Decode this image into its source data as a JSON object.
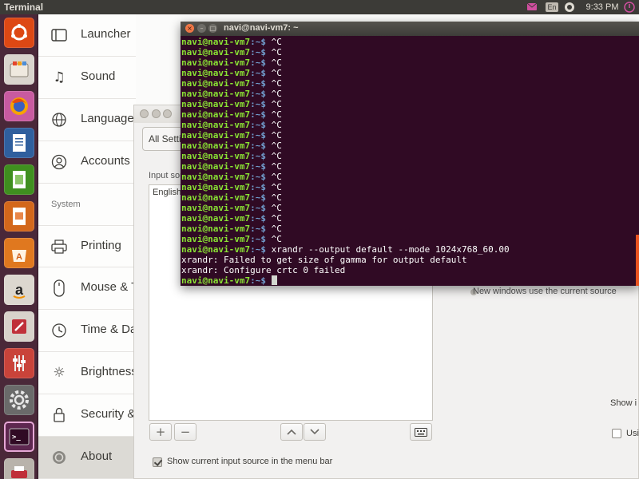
{
  "top_panel": {
    "title": "Terminal",
    "keyboard_indicator": "En",
    "time": "9:33 PM"
  },
  "launcher": {
    "items": [
      {
        "name": "dash-icon",
        "color": "#dd4814"
      },
      {
        "name": "files-icon",
        "color": "#c9c4bd"
      },
      {
        "name": "firefox-icon",
        "color": "#e66000"
      },
      {
        "name": "writer-icon",
        "color": "#2f5f9e"
      },
      {
        "name": "calc-icon",
        "color": "#3f8f1f"
      },
      {
        "name": "impress-icon",
        "color": "#c65a12"
      },
      {
        "name": "software-center-icon",
        "color": "#e0781f"
      },
      {
        "name": "amazon-icon",
        "color": "#c9c4bd"
      },
      {
        "name": "system-tool-icon",
        "color": "#c0303a"
      },
      {
        "name": "settings-icon",
        "color": "#8d7a6c"
      },
      {
        "name": "system-gear-icon",
        "color": "#6a6a6a"
      },
      {
        "name": "terminal-icon",
        "color": "#5e2750"
      },
      {
        "name": "printer-icon",
        "color": "#b33a3a"
      }
    ]
  },
  "settings": {
    "sidebar": {
      "items": [
        {
          "label": "Launcher"
        },
        {
          "label": "Sound"
        },
        {
          "label": "Language & Region"
        },
        {
          "label": "Accounts"
        },
        {
          "label": "Printing"
        },
        {
          "label": "Mouse & Touchpad"
        },
        {
          "label": "Time & Date"
        },
        {
          "label": "Brightness"
        },
        {
          "label": "Security & Privacy"
        },
        {
          "label": "About"
        }
      ],
      "section_system": "System"
    }
  },
  "dialog": {
    "all_settings_label": "All Settings",
    "input_sources_label": "Input sources to use:",
    "sources": [
      "English"
    ],
    "show_in_menu_label": "Show current input source in the menu bar",
    "show_in_menu_checked": true,
    "new_windows_label": "New windows use the current source",
    "show_i_label": "Show i",
    "usi_label": "Usi"
  },
  "terminal": {
    "title": "navi@navi-vm7: ~",
    "prompt_user": "navi@navi-vm7",
    "prompt_path": ":~$",
    "lines": [
      {
        "type": "prompt",
        "text": " ^C"
      },
      {
        "type": "prompt",
        "text": " ^C"
      },
      {
        "type": "prompt",
        "text": " ^C"
      },
      {
        "type": "prompt",
        "text": " ^C"
      },
      {
        "type": "prompt",
        "text": " ^C"
      },
      {
        "type": "prompt",
        "text": " ^C"
      },
      {
        "type": "prompt",
        "text": " ^C"
      },
      {
        "type": "prompt",
        "text": " ^C"
      },
      {
        "type": "prompt",
        "text": " ^C"
      },
      {
        "type": "prompt",
        "text": " ^C"
      },
      {
        "type": "prompt",
        "text": " ^C"
      },
      {
        "type": "prompt",
        "text": " ^C"
      },
      {
        "type": "prompt",
        "text": " ^C"
      },
      {
        "type": "prompt",
        "text": " ^C"
      },
      {
        "type": "prompt",
        "text": " ^C"
      },
      {
        "type": "prompt",
        "text": " ^C"
      },
      {
        "type": "prompt",
        "text": " ^C"
      },
      {
        "type": "prompt",
        "text": " ^C"
      },
      {
        "type": "prompt",
        "text": " ^C"
      },
      {
        "type": "prompt",
        "text": " ^C"
      },
      {
        "type": "prompt",
        "text": " xrandr --output default --mode 1024x768_60.00"
      },
      {
        "type": "output",
        "text": "xrandr: Failed to get size of gamma for output default"
      },
      {
        "type": "output",
        "text": "xrandr: Configure crtc 0 failed"
      },
      {
        "type": "prompt_cursor",
        "text": " "
      }
    ]
  }
}
